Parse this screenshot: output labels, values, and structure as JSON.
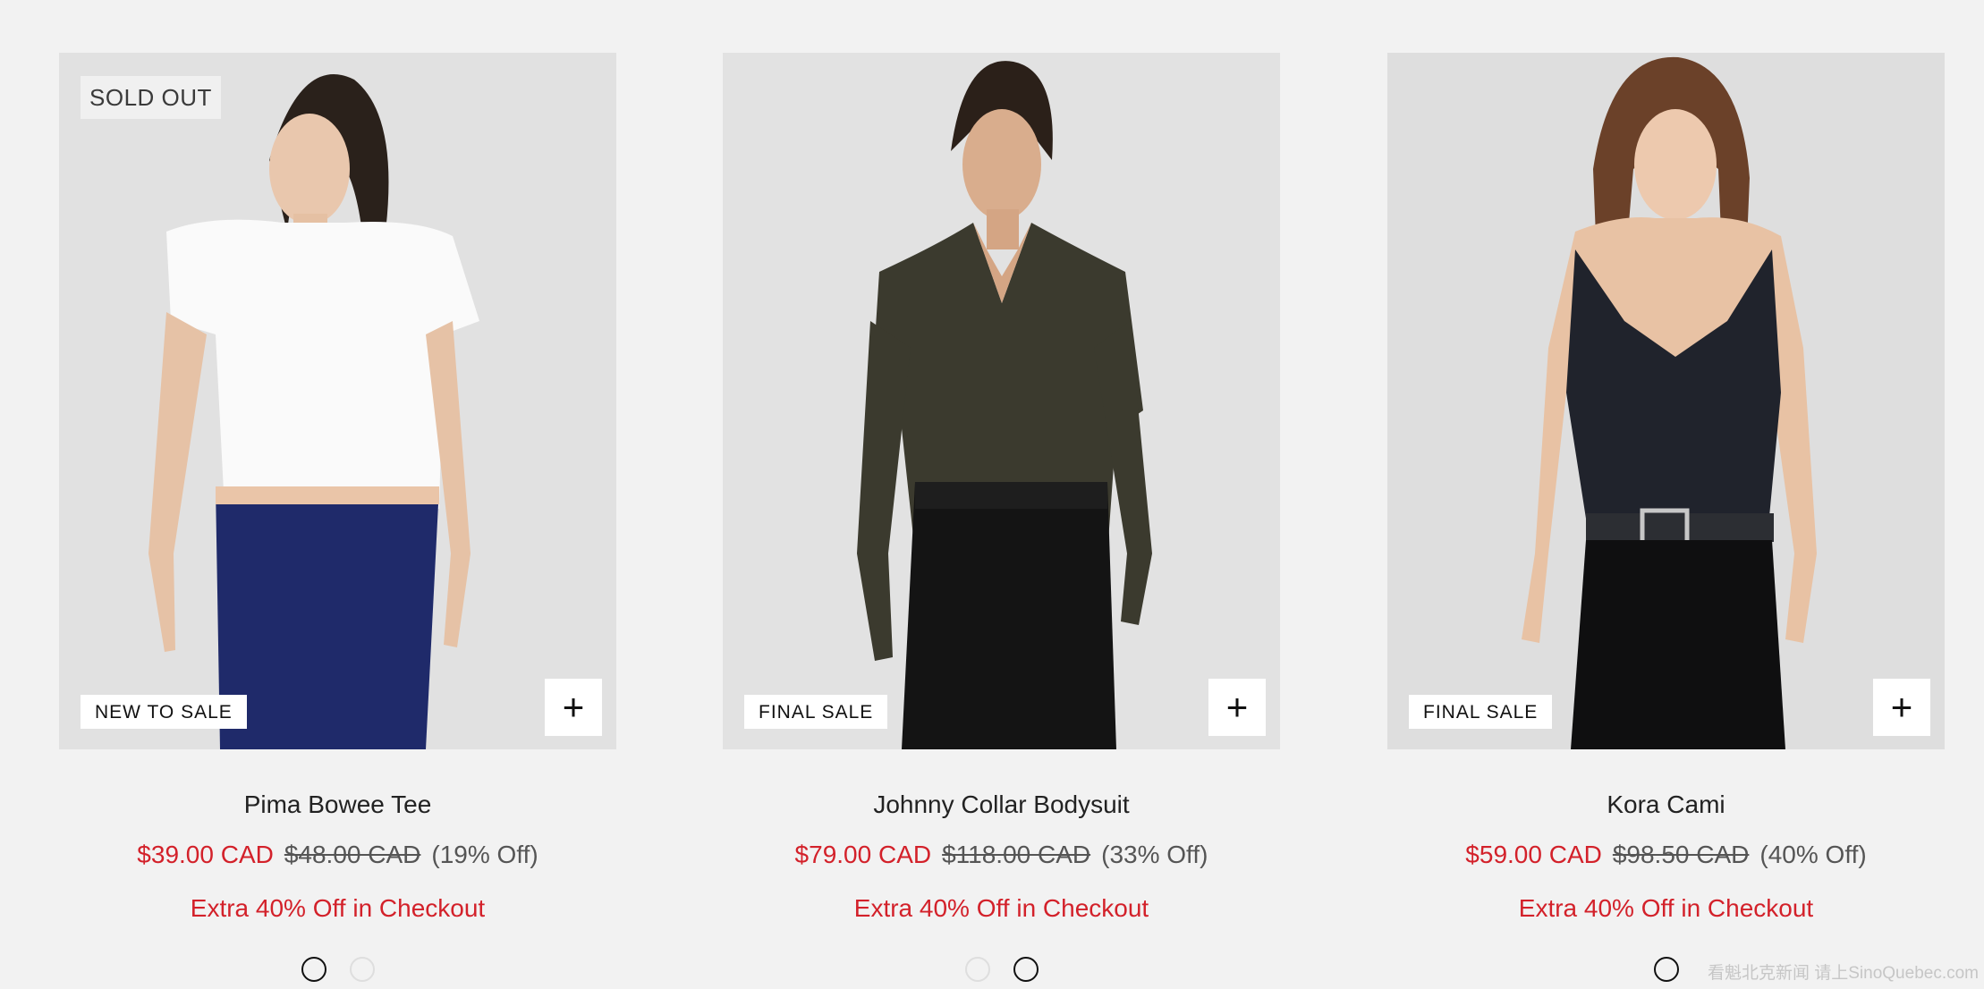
{
  "products": [
    {
      "top_badge": "SOLD OUT",
      "bottom_badge": "NEW TO SALE",
      "name": "Pima Bowee Tee",
      "sale_price": "$39.00 CAD",
      "original_price": "$48.00 CAD",
      "discount": "(19% Off)",
      "promo": "Extra 40% Off in Checkout",
      "quick_add": "+"
    },
    {
      "bottom_badge": "FINAL SALE",
      "name": "Johnny Collar Bodysuit",
      "sale_price": "$79.00 CAD",
      "original_price": "$118.00 CAD",
      "discount": "(33% Off)",
      "promo": "Extra 40% Off in Checkout",
      "quick_add": "+"
    },
    {
      "bottom_badge": "FINAL SALE",
      "name": "Kora Cami",
      "sale_price": "$59.00 CAD",
      "original_price": "$98.50 CAD",
      "discount": "(40% Off)",
      "promo": "Extra 40% Off in Checkout",
      "quick_add": "+"
    }
  ],
  "watermark": "看魁北克新闻 请上SinoQuebec.com",
  "colors": {
    "sale_red": "#d3212a",
    "background": "#f2f2f2"
  }
}
